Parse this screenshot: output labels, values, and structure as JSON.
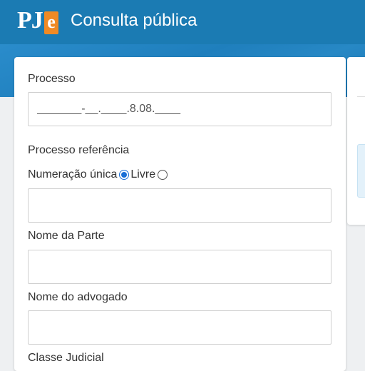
{
  "header": {
    "logo_text": "PJe",
    "title": "Consulta pública"
  },
  "form": {
    "processo": {
      "label": "Processo",
      "placeholder": "_______-__.____.8.08.____",
      "value": ""
    },
    "processo_referencia": {
      "label": "Processo referência"
    },
    "numeracao": {
      "option_unica_label": "Numeração única",
      "option_livre_label": "Livre",
      "selected": "Numeração única",
      "value": ""
    },
    "nome_parte": {
      "label": "Nome da Parte",
      "value": ""
    },
    "nome_advogado": {
      "label": "Nome do advogado",
      "value": ""
    },
    "classe_judicial": {
      "label": "Classe Judicial"
    }
  }
}
